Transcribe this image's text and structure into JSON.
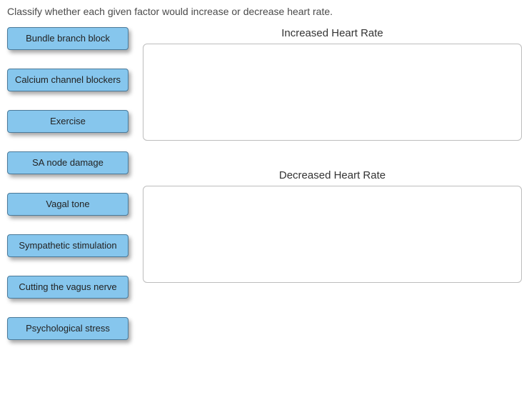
{
  "instruction": "Classify whether each given factor would increase or decrease heart rate.",
  "factors": [
    {
      "label": "Bundle branch block"
    },
    {
      "label": "Calcium channel blockers"
    },
    {
      "label": "Exercise"
    },
    {
      "label": "SA node damage"
    },
    {
      "label": "Vagal tone"
    },
    {
      "label": "Sympathetic stimulation"
    },
    {
      "label": "Cutting the vagus nerve"
    },
    {
      "label": "Psychological stress"
    }
  ],
  "dropzones": {
    "increased": {
      "title": "Increased Heart Rate"
    },
    "decreased": {
      "title": "Decreased Heart Rate"
    }
  }
}
